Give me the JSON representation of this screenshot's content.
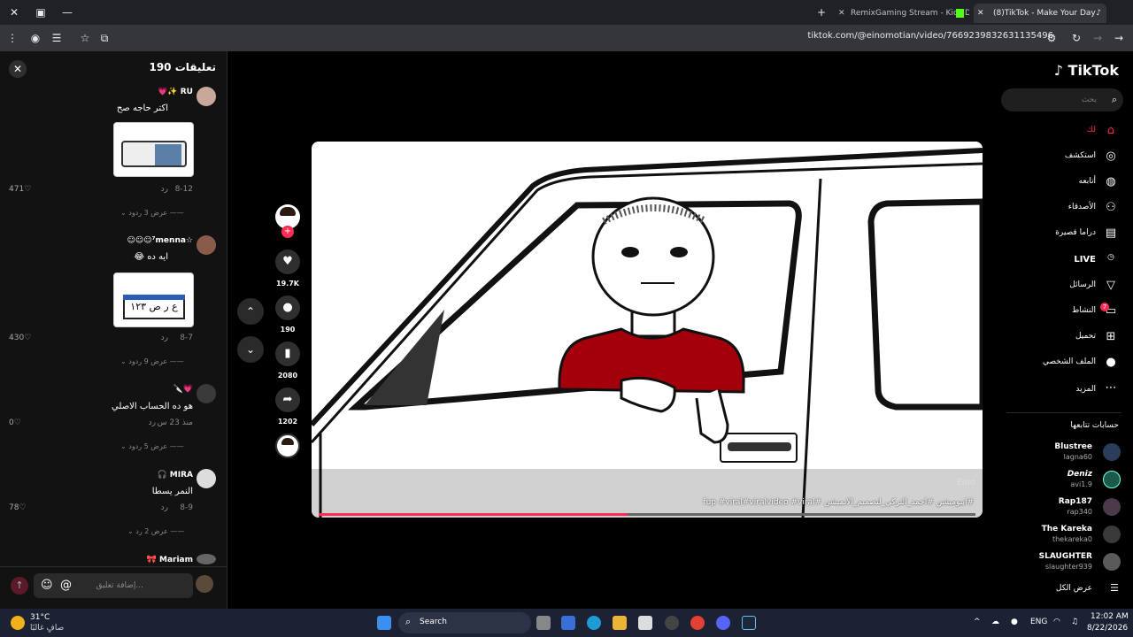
{
  "browser": {
    "tabs": [
      {
        "label": "RemixGaming Stream - Kick Da",
        "active": false
      },
      {
        "label": "(8)TikTok - Make Your Day",
        "active": true
      }
    ],
    "url": "tiktok.com/@einomotian/video/7669239832631135496"
  },
  "comments": {
    "title": "تعليقات 190",
    "items": [
      {
        "user": "RU ✨💗",
        "text": "اكتر حاجه صح",
        "date": "8-12",
        "reply": "رد",
        "likes": "471",
        "more": "عرض 3 ردود"
      },
      {
        "user": "☆⁷menna☺☺☺",
        "text": "ايه ده 😂",
        "date": "8-7",
        "reply": "رد",
        "likes": "430",
        "more": "عرض 9 ردود"
      },
      {
        "user": "💗🔪",
        "text": "هو ده الحساب الاصلي",
        "date": "منذ 23 س",
        "reply": "رد",
        "likes": "0",
        "more": "عرض 5 ردود"
      },
      {
        "user": "MIRA 🎧",
        "text": "النمر يسطا",
        "date": "8-9",
        "reply": "رد",
        "likes": "78",
        "more": "عرض 2 رد"
      },
      {
        "user": "Mariam 🎀",
        "text": "",
        "date": "",
        "reply": "",
        "likes": "",
        "more": ""
      }
    ],
    "sticker2_text": "ع ر ص ١٢٣",
    "input_placeholder": "إضافة تعليق..."
  },
  "actions": {
    "likes": "19.7K",
    "comments": "190",
    "saves": "2080",
    "shares": "1202"
  },
  "video": {
    "caption": "#اينوميشن #احمد_التركي_لتصميم_الانميشن #fup #viral#viralvideo #viral",
    "watermark": "Eino",
    "progress": 0.47
  },
  "sidebar": {
    "logo": "TikTok",
    "search_placeholder": "بحث",
    "nav": [
      {
        "label": "لك",
        "icon": "home-icon"
      },
      {
        "label": "استكشف",
        "icon": "compass-icon"
      },
      {
        "label": "أتابعه",
        "icon": "following-icon"
      },
      {
        "label": "الأصدقاء",
        "icon": "friends-icon"
      },
      {
        "label": "دراما قصيرة",
        "icon": "drama-icon"
      },
      {
        "label": "LIVE",
        "icon": "live-icon"
      },
      {
        "label": "الرسائل",
        "icon": "send-icon"
      },
      {
        "label": "النشاط",
        "icon": "activity-icon"
      },
      {
        "label": "تحميل",
        "icon": "upload-icon"
      },
      {
        "label": "الملف الشخصي",
        "icon": "profile-icon"
      },
      {
        "label": "المزيد",
        "icon": "more-icon"
      }
    ],
    "following_title": "حسابات تتابعها",
    "following": [
      {
        "name": "Blustree",
        "handle": "lagna60"
      },
      {
        "name": "Deniz",
        "handle": "avi1.9"
      },
      {
        "name": "Rap187",
        "handle": "rap340"
      },
      {
        "name": "The Kareka",
        "handle": "thekareka0"
      },
      {
        "name": "SLAUGHTER",
        "handle": "slaughter939"
      }
    ],
    "see_all": "عرض الكل",
    "activity_badge": "7"
  },
  "taskbar": {
    "weather_temp": "31°C",
    "weather_desc": "صافٍ غالبًا",
    "search": "Search",
    "lang": "ENG",
    "time": "12:02 AM",
    "date": "8/22/2026"
  }
}
